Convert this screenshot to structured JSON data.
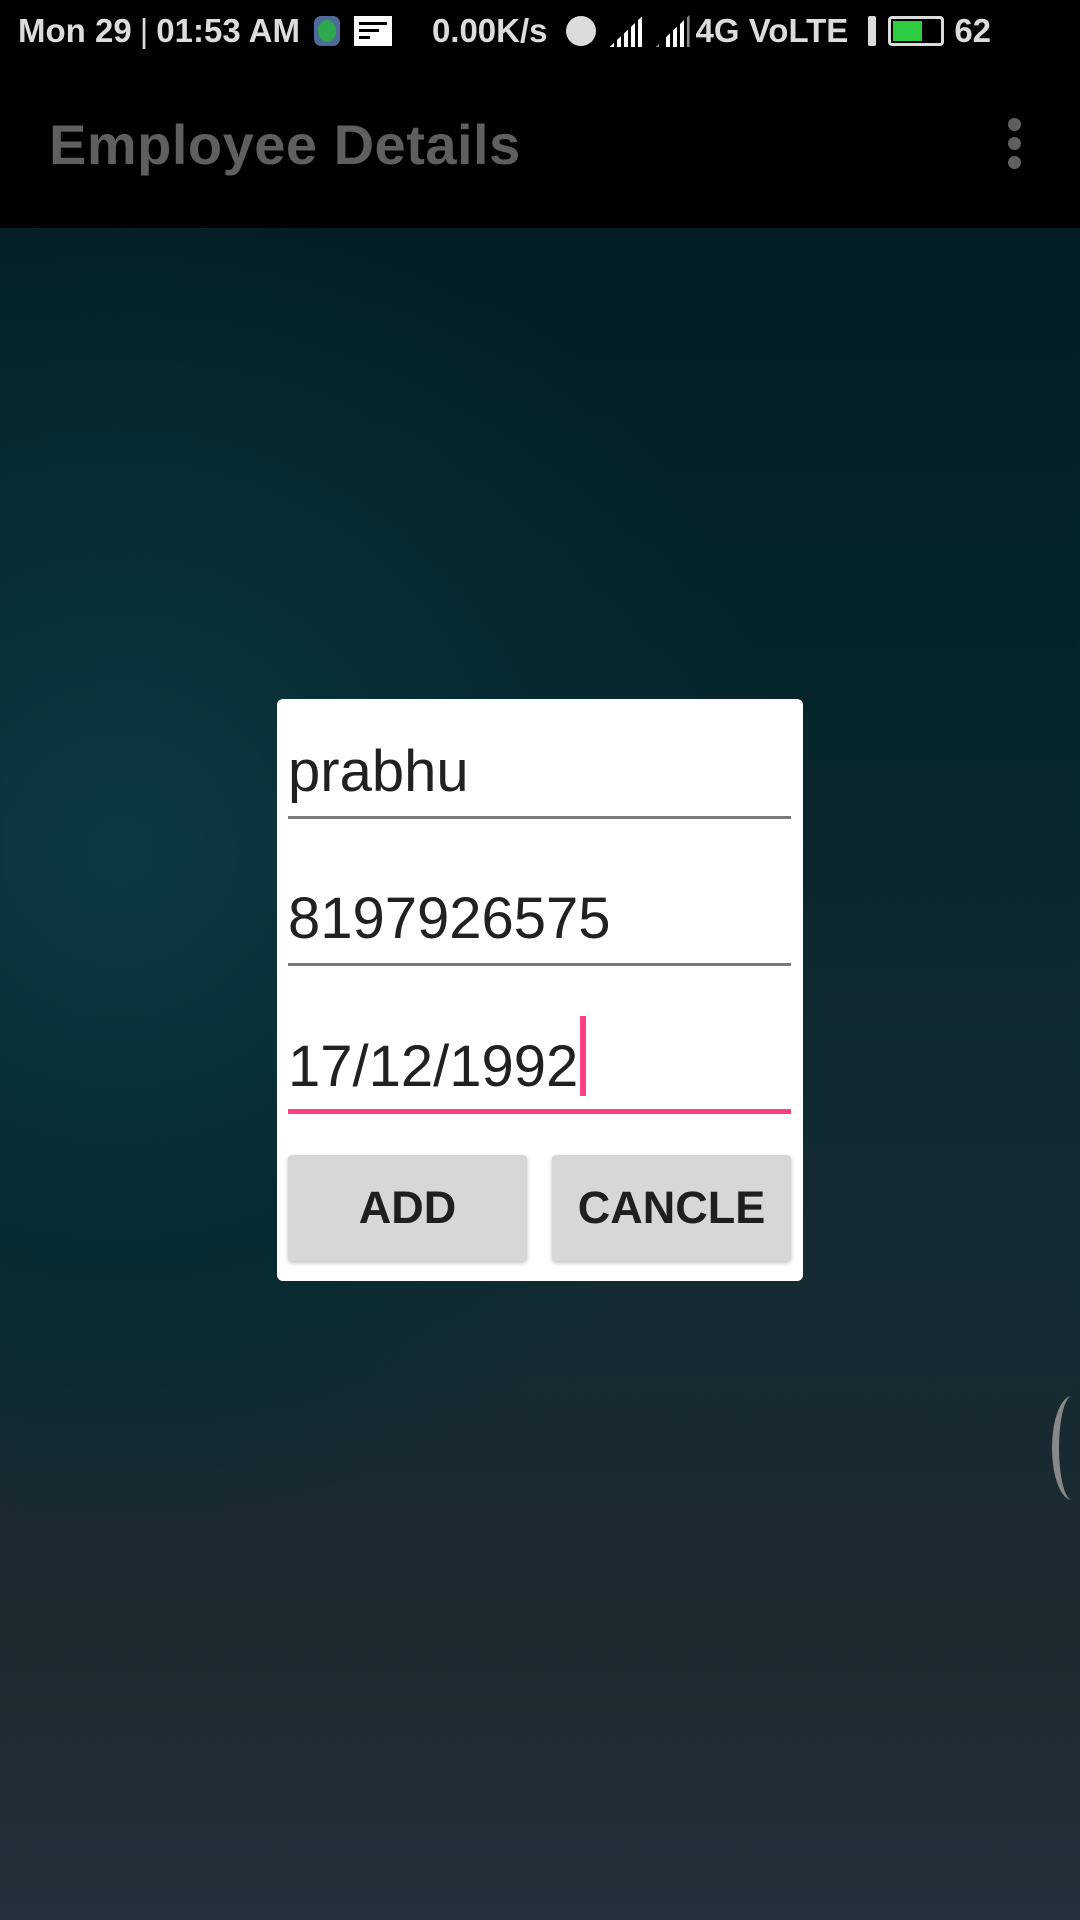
{
  "status_bar": {
    "date": "Mon 29",
    "time": "01:53 AM",
    "speed": "0.00K/s",
    "network": "4G VoLTE",
    "battery": "62",
    "battery_level_percent": 62,
    "battery_color": "#2ecc40",
    "icons": [
      "usb-debug-icon",
      "notification-icon",
      "alarm-icon",
      "signal-icon",
      "signal-icon",
      "charging-icon",
      "battery-icon"
    ]
  },
  "app_bar": {
    "title": "Employee Details",
    "menu_icon": "overflow-menu-icon"
  },
  "dialog": {
    "fields": [
      {
        "value": "prabhu"
      },
      {
        "value": "8197926575"
      },
      {
        "value": "17/12/1992"
      }
    ],
    "add_label": "ADD",
    "cancel_label": "CANCLE",
    "accent": "#ff4081"
  }
}
